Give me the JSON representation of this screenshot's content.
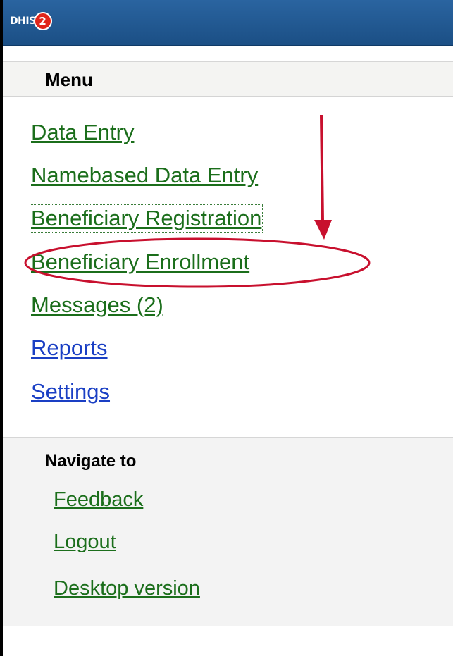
{
  "header": {
    "logo_text": "DHIS",
    "logo_badge": "2"
  },
  "menu": {
    "title": "Menu",
    "items": [
      {
        "label": "Data Entry"
      },
      {
        "label": "Namebased Data Entry"
      },
      {
        "label": "Beneficiary Registration"
      },
      {
        "label": "Beneficiary Enrollment"
      },
      {
        "label": "Messages (2)"
      },
      {
        "label": "Reports"
      },
      {
        "label": "Settings"
      }
    ]
  },
  "navigate": {
    "title": "Navigate to",
    "items": [
      {
        "label": "Feedback"
      },
      {
        "label": "Logout"
      },
      {
        "label": "Desktop version"
      }
    ]
  },
  "colors": {
    "header_blue": "#1d5288",
    "link_green": "#1b6e1b",
    "link_blue": "#1a3fc4",
    "annotation_red": "#c8102e"
  }
}
